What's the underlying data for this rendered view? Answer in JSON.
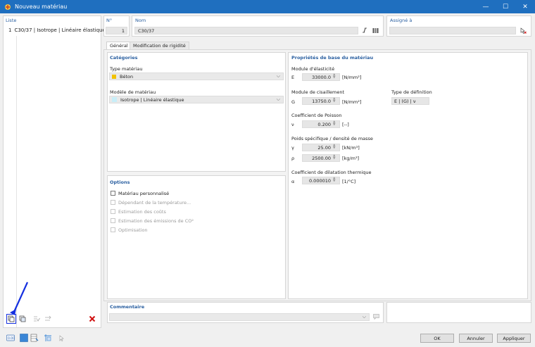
{
  "window": {
    "title": "Nouveau matériau",
    "minimize": "—",
    "maximize": "☐",
    "close": "✕"
  },
  "list": {
    "header": "Liste",
    "items": [
      {
        "number": "1",
        "label": "C30/37 | Isotrope | Linéaire élastique"
      }
    ]
  },
  "top": {
    "no_label": "N°",
    "no_value": "1",
    "name_label": "Nom",
    "name_value": "C30/37",
    "assigned_label": "Assigné à"
  },
  "tabs": {
    "general": "Général",
    "stiffness": "Modification de rigidité"
  },
  "categories": {
    "header": "Catégories",
    "material_type_label": "Type matériau",
    "material_type_value": "Béton",
    "material_type_color": "#f2c200",
    "model_label": "Modèle de matériau",
    "model_value": "Isotrope | Linéaire élastique",
    "model_color": "#c8eef8"
  },
  "options": {
    "header": "Options",
    "items": [
      {
        "label": "Matériau personnalisé",
        "enabled": true
      },
      {
        "label": "Dépendant de la température...",
        "enabled": false
      },
      {
        "label": "Estimation des coûts",
        "enabled": false
      },
      {
        "label": "Estimation des émissions de CO²",
        "enabled": false
      },
      {
        "label": "Optimisation",
        "enabled": false
      }
    ]
  },
  "properties": {
    "header": "Propriétés de base du matériau",
    "elasticity_label": "Module d'élasticité",
    "E_symbol": "E",
    "E_value": "33000.0",
    "E_unit": "[N/mm²]",
    "shear_label": "Module de cisaillement",
    "G_symbol": "G",
    "G_value": "13750.0",
    "G_unit": "[N/mm²]",
    "definition_label": "Type de définition",
    "definition_value": "E | (G) | ν",
    "poisson_label": "Coefficient de Poisson",
    "nu_symbol": "ν",
    "nu_value": "0.200",
    "nu_unit": "[--]",
    "weight_label": "Poids spécifique / densité de masse",
    "gamma_symbol": "γ",
    "gamma_value": "25.00",
    "gamma_unit": "[kN/m³]",
    "rho_symbol": "ρ",
    "rho_value": "2500.00",
    "rho_unit": "[kg/m³]",
    "thermal_label": "Coefficient de dilatation thermique",
    "alpha_symbol": "α",
    "alpha_value": "0.000010",
    "alpha_unit": "[1/°C]"
  },
  "comment": {
    "header": "Commentaire"
  },
  "buttons": {
    "ok": "OK",
    "cancel": "Annuler",
    "apply": "Appliquer"
  },
  "colors": {
    "accent": "#1f6fbf",
    "header_text": "#2a5fa0",
    "delete": "#d01010",
    "annotation": "#1530e0"
  }
}
